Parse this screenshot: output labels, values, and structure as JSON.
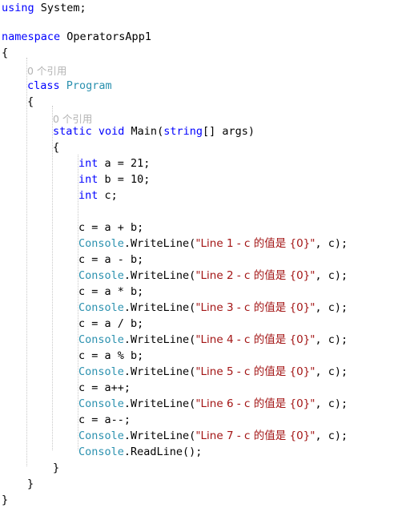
{
  "editor": {
    "language": "C#",
    "colors": {
      "background": "#ffffff",
      "keyword": "#0000ff",
      "type": "#2b91af",
      "string": "#a31515",
      "plain": "#000000",
      "codelens": "#b4b4b4",
      "indent_guide": "#c8c8c8"
    }
  },
  "codelens": {
    "class_references": "0 个引用",
    "method_references": "0 个引用"
  },
  "code": {
    "using_keyword": "using",
    "using_namespace": " System;",
    "namespace_keyword": "namespace",
    "namespace_name": " OperatorsApp1",
    "brace_open_ns": "{",
    "class_keyword": "class",
    "class_name": "Program",
    "brace_open_class": "{",
    "method_modifiers": "static void ",
    "method_name": "Main",
    "method_paren_open": "(",
    "method_param_type": "string",
    "method_param_rest": "[] args)",
    "brace_open_method": "{",
    "decl_a_kw": "int",
    "decl_a_rest": " a = 21;",
    "decl_b_kw": "int",
    "decl_b_rest": " b = 10;",
    "decl_c_kw": "int",
    "decl_c_rest": " c;",
    "assign_1": "c = a + b;",
    "assign_2": "c = a - b;",
    "assign_3": "c = a * b;",
    "assign_4": "c = a / b;",
    "assign_5": "c = a % b;",
    "assign_6": "c = a++;",
    "assign_7": "c = a--;",
    "console_type": "Console",
    "writeline_call": ".WriteLine(",
    "readline_stmt": ".ReadLine();",
    "arg_tail": ", c);",
    "strings": [
      "\"Line 1 - c 的值是 {0}\"",
      "\"Line 2 - c 的值是 {0}\"",
      "\"Line 3 - c 的值是 {0}\"",
      "\"Line 4 - c 的值是 {0}\"",
      "\"Line 5 - c 的值是 {0}\"",
      "\"Line 6 - c 的值是 {0}\"",
      "\"Line 7 - c 的值是 {0}\""
    ],
    "brace_close_method": "}",
    "brace_close_class": "}",
    "brace_close_ns": "}"
  }
}
